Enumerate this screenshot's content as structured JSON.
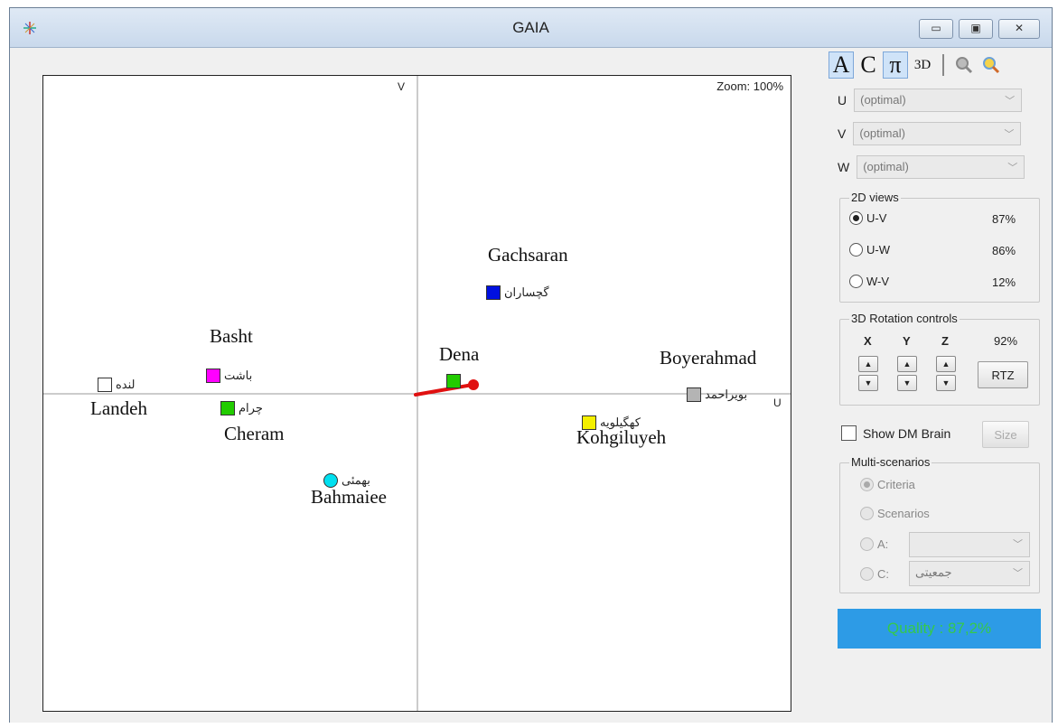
{
  "window": {
    "title": "GAIA",
    "controls": {
      "minimize": "▭",
      "maximize": "▣",
      "close": "✕"
    }
  },
  "plot": {
    "zoom_label": "Zoom: 100%",
    "axis_v_label": "V",
    "axis_u_label": "U",
    "points": [
      {
        "label": "گچساران",
        "color": "#0010e0"
      },
      {
        "label": "باشت",
        "color": "#ff00ff"
      },
      {
        "label": "لنده",
        "color": "#ffffff"
      },
      {
        "label": "چرام",
        "color": "#22cc00"
      },
      {
        "label": "بهمئی",
        "color": "#00e0f0"
      },
      {
        "label": "بویراحمد",
        "color": "#b4b4b4"
      },
      {
        "label": "کهگیلویه",
        "color": "#f5f000"
      },
      {
        "label": "",
        "color": "#22cc00"
      }
    ],
    "annotations": [
      "Gachsaran",
      "Basht",
      "Dena",
      "Boyerahmad",
      "Landeh",
      "Cheram",
      "Kohgiluyeh",
      "Bahmaiee"
    ],
    "decision_stick_color": "#e01010"
  },
  "toolbar": {
    "tools": [
      {
        "label": "A",
        "icon": "analysis-mode-icon",
        "active": true
      },
      {
        "label": "C",
        "icon": "criteria-mode-icon",
        "active": false
      },
      {
        "label": "π",
        "icon": "pi-mode-icon",
        "active": true
      },
      {
        "label": "3D",
        "icon": "3d-mode-icon",
        "active": false
      }
    ],
    "zoom_icon": "zoom-icon",
    "color_zoom_icon": "color-zoom-icon"
  },
  "axes_select": [
    {
      "axis": "U",
      "value": "(optimal)"
    },
    {
      "axis": "V",
      "value": "(optimal)"
    },
    {
      "axis": "W",
      "value": "(optimal)"
    }
  ],
  "views_2d": {
    "title": "2D views",
    "options": [
      {
        "label": "U-V",
        "pct": "87%",
        "selected": true
      },
      {
        "label": "U-W",
        "pct": "86%",
        "selected": false
      },
      {
        "label": "W-V",
        "pct": "12%",
        "selected": false
      }
    ]
  },
  "rotation_3d": {
    "title": "3D Rotation controls",
    "axes": [
      "X",
      "Y",
      "Z"
    ],
    "pct": "92%",
    "up": "▲",
    "down": "▼",
    "rtz_label": "RTZ"
  },
  "dm_brain": {
    "label": "Show DM Brain",
    "checked": false,
    "size_label": "Size"
  },
  "multi_scenarios": {
    "title": "Multi-scenarios",
    "criteria_label": "Criteria",
    "scenarios_label": "Scenarios",
    "a_label": "A:",
    "a_value": "",
    "c_label": "C:",
    "c_value": "جمعیتی"
  },
  "quality": {
    "text": "Quality : 87,2%"
  }
}
